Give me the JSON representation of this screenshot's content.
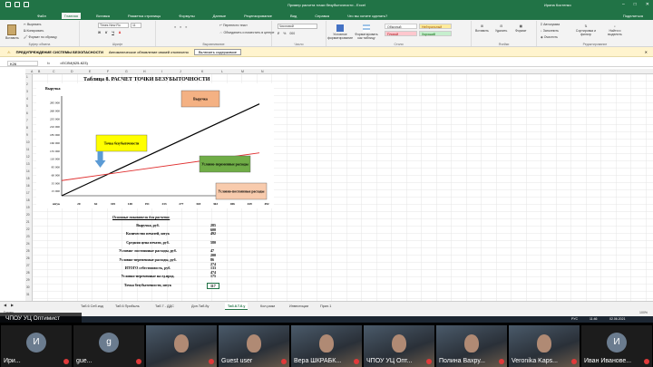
{
  "window": {
    "title": "Пример расчета точки безубыточности - Excel",
    "user": "Ирина Костенко"
  },
  "menu": [
    "Файл",
    "Главная",
    "Вставка",
    "Разметка страницы",
    "Формулы",
    "Данные",
    "Рецензирование",
    "Вид",
    "Справка",
    "Что вы хотите сделать?"
  ],
  "menu_active": 1,
  "share_label": "Поделиться",
  "ribbon": {
    "clipboard": {
      "paste": "Вставить",
      "cut": "Вырезать",
      "copy": "Копировать",
      "format_painter": "Формат по образцу",
      "label": "Буфер обмена"
    },
    "font": {
      "name": "Times New Ro",
      "size": "11",
      "label": "Шрифт"
    },
    "alignment": {
      "wrap": "Перенести текст",
      "merge": "Объединить и поместить в центре",
      "label": "Выравнивание"
    },
    "number": {
      "format": "Числовой",
      "label": "Число"
    },
    "styles": {
      "conditional": "Условное форматирование",
      "as_table": "Форматировать как таблицу",
      "normal": "Обычный",
      "neutral": "Нейтральный",
      "bad": "Плохой",
      "good": "Хороший",
      "label": "Стили"
    },
    "cells": {
      "insert": "Вставить",
      "delete": "Удалить",
      "format": "Формат",
      "label": "Ячейки"
    },
    "editing": {
      "autosum": "Автосумма",
      "fill": "Заполнить",
      "clear": "Очистить",
      "sort": "Сортировка и фильтр",
      "find": "Найти и выделить",
      "label": "Редактирование"
    }
  },
  "security_bar": {
    "title": "ПРЕДУПРЕЖДЕНИЕ СИСТЕМЫ БЕЗОПАСНОСТИ",
    "message": "Автоматическое обновление связей отключено",
    "button": "Включить содержимое"
  },
  "formula_bar": {
    "name_box": "K26",
    "fx": "fx",
    "formula": "=ЕСЛИ(К25-К23)"
  },
  "columns": [
    "A",
    "B",
    "C",
    "D",
    "E",
    "F",
    "G",
    "H",
    "I",
    "J",
    "K",
    "L",
    "M",
    "N"
  ],
  "rows": [
    "1",
    "2",
    "3",
    "4",
    "5",
    "6",
    "7",
    "8",
    "9",
    "10",
    "11",
    "12",
    "13",
    "14",
    "15",
    "16",
    "17",
    "18",
    "19",
    "20",
    "21",
    "22",
    "23",
    "24",
    "25",
    "26",
    "27",
    "28",
    "29",
    "30",
    "31"
  ],
  "sheet": {
    "title": "Таблица 8. РАСЧЕТ ТОЧКИ БЕЗУБЫТОЧНОСТИ",
    "calc_heading": "Основные показатели для расчета:",
    "calc_rows": [
      {
        "label": "Выручка, руб.",
        "value": "285 600"
      },
      {
        "label": "Количество печатей, штук",
        "value": "492"
      },
      {
        "label": "Средняя цена печати, руб.",
        "value": "580"
      },
      {
        "label": "Условно- постоянные расходы, руб.",
        "value": "47 200"
      },
      {
        "label": "Условно-переменные расходы, руб.",
        "value": "86 274"
      },
      {
        "label": "ИТОГО себестоимость, руб.",
        "value": "133 474"
      },
      {
        "label": "Условно-переменные на ед.прод.",
        "value": "175"
      },
      {
        "label": "Точка безубыточности, штук",
        "value": "117"
      }
    ]
  },
  "chart_data": {
    "type": "line",
    "y_title": "Выручка",
    "x_title": "штук",
    "x": [
      0,
      21,
      42,
      63,
      84,
      105,
      126,
      148,
      169,
      191,
      212,
      233,
      254,
      275,
      297,
      318,
      339,
      360,
      381,
      402,
      424,
      445,
      466,
      492
    ],
    "x_ticks": [
      "штук",
      "20",
      "62",
      "105",
      "148",
      "191",
      "233",
      "277",
      "318",
      "363",
      "406",
      "449",
      "492"
    ],
    "y_ticks": [
      "15 000",
      "35 000",
      "60 000",
      "85 000",
      "110 000",
      "135 000",
      "160 000",
      "185 000",
      "210 000",
      "235 000",
      "260 000",
      "285 000"
    ],
    "series": [
      {
        "name": "Выручка",
        "color": "#000000",
        "points": [
          [
            0,
            0
          ],
          [
            492,
            285600
          ]
        ]
      },
      {
        "name": "Условно-переменные расходы",
        "color": "#e03030",
        "points": [
          [
            0,
            47200
          ],
          [
            492,
            133474
          ]
        ]
      },
      {
        "name": "Условно-постоянные расходы",
        "color": "#1f4fd1",
        "points": [
          [
            0,
            47200
          ],
          [
            492,
            47200
          ]
        ]
      }
    ],
    "annotations": [
      {
        "text": "Выручка",
        "fill": "#f4b183"
      },
      {
        "text": "Точка безубыточности",
        "fill": "#ffff00"
      },
      {
        "text": "Условно-переменные расходы",
        "fill": "#70ad47"
      },
      {
        "text": "Условно-постоянные расходы",
        "fill": "#f8cbad"
      }
    ],
    "ylim": [
      0,
      310000
    ],
    "xlim": [
      0,
      510
    ]
  },
  "sheet_tabs": [
    "Таб.6 Себ.изд",
    "Таб.6 Прибыль",
    "Таб.7 - ДДС",
    "Доп.Таб.8у",
    "Таб.8.Т.б.у",
    "Кол.разм",
    "Инвестиции",
    "Прил.1"
  ],
  "active_tab": 4,
  "status": {
    "left": "Готово",
    "right": "100%"
  },
  "taskbar": {
    "lang": "РУС",
    "time": "11:46",
    "date": "02.06.2021"
  },
  "name_label": "ЧПОУ УЦ Оптимист",
  "participants": [
    {
      "name": "Ири...",
      "initial": "И",
      "video": false
    },
    {
      "name": "gue...",
      "initial": "g",
      "video": false
    },
    {
      "name": "",
      "initial": "",
      "video": true
    },
    {
      "name": "Guest user",
      "initial": "",
      "video": true
    },
    {
      "name": "Вера ШКРАБК...",
      "initial": "",
      "video": true
    },
    {
      "name": "ЧПОУ УЦ Опт...",
      "initial": "",
      "video": true
    },
    {
      "name": "Полина Вахру...",
      "initial": "",
      "video": true
    },
    {
      "name": "Veronika Kaps...",
      "initial": "",
      "video": true
    },
    {
      "name": "Иван Иванове...",
      "initial": "И",
      "video": false
    }
  ]
}
